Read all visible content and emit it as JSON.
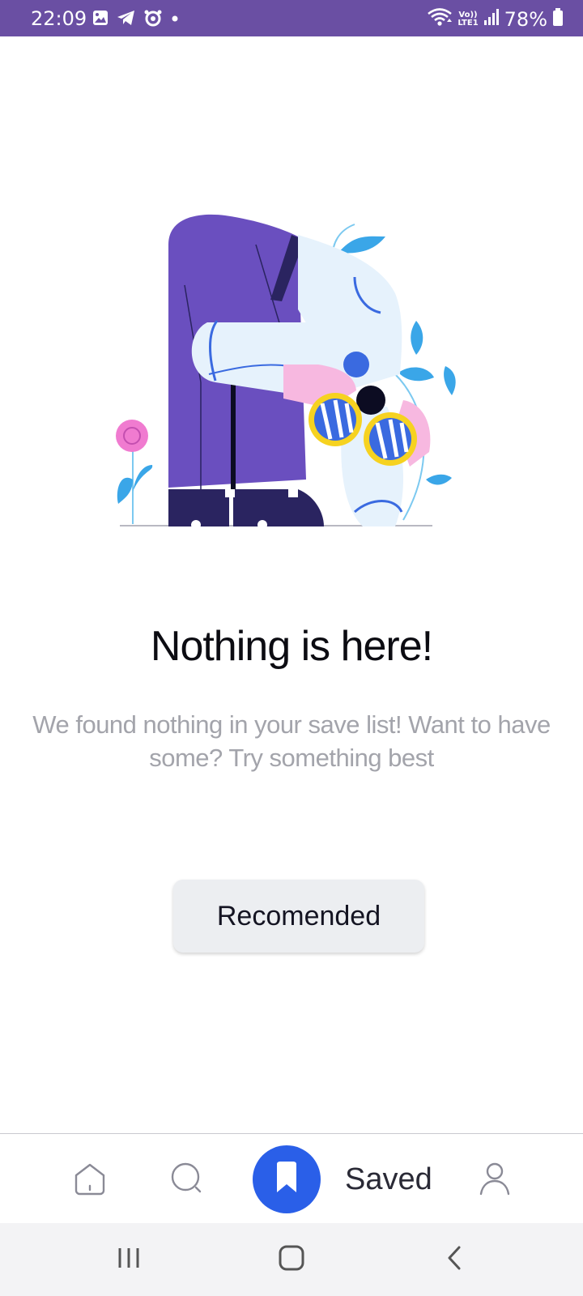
{
  "status_bar": {
    "time": "22:09",
    "notification_icons": [
      "gallery-icon",
      "telegram-icon",
      "alarm-icon",
      "dot-icon"
    ],
    "network_label_top": "Vo))",
    "network_label_bottom": "LTE1",
    "battery_percent": "78%",
    "background_color": "#6a4fa3"
  },
  "empty_state": {
    "title": "Nothing is here!",
    "message": "We found nothing in your save list! Want to have some? Try something best",
    "button_label": "Recomended"
  },
  "bottom_nav": {
    "items": [
      {
        "name": "home",
        "icon": "home-icon"
      },
      {
        "name": "search",
        "icon": "search-icon"
      },
      {
        "name": "saved",
        "icon": "bookmark-icon",
        "label": "Saved",
        "active": true
      },
      {
        "name": "profile",
        "icon": "user-icon"
      }
    ],
    "active_color": "#2a5fe8"
  },
  "system_nav": {
    "buttons": [
      "recent-apps-icon",
      "home-button-icon",
      "back-icon"
    ]
  }
}
